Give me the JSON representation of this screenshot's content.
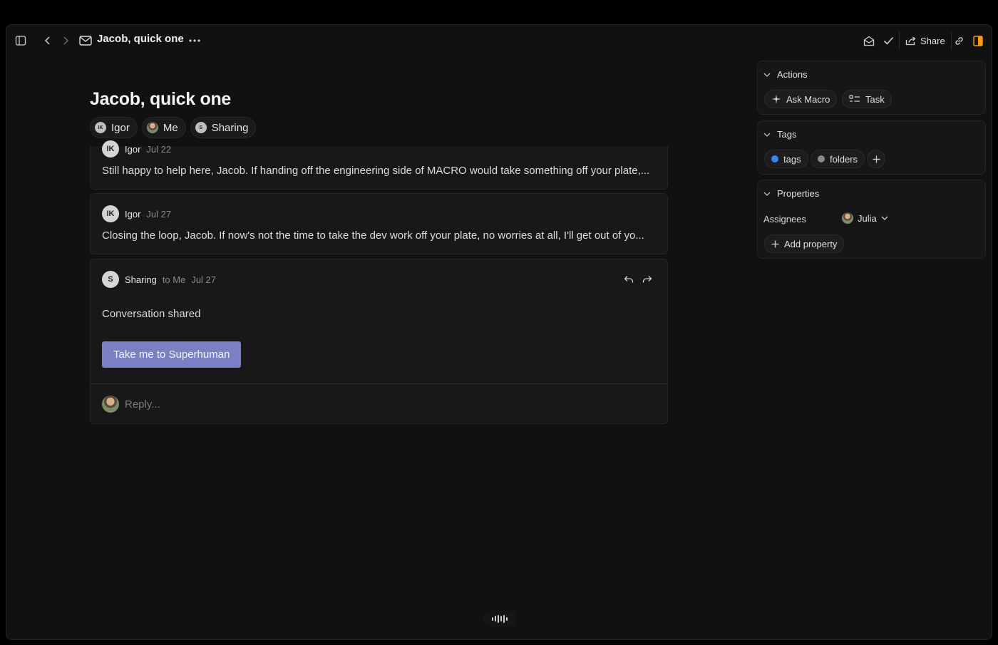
{
  "header": {
    "title": "Jacob, quick one",
    "share_label": "Share"
  },
  "document": {
    "title": "Jacob, quick one",
    "participants": [
      {
        "initials": "IK",
        "name": "Igor"
      },
      {
        "initials": "",
        "name": "Me"
      },
      {
        "initials": "S",
        "name": "Sharing"
      }
    ]
  },
  "messages": [
    {
      "initials": "IK",
      "sender": "Igor",
      "to": "",
      "date": "Jul 22",
      "snippet": "Still happy to help here, Jacob. If handing off the engineering side of MACRO would take something off your plate,..."
    },
    {
      "initials": "IK",
      "sender": "Igor",
      "to": "",
      "date": "Jul 27",
      "snippet": "Closing the loop, Jacob. If now's not the time to take the dev work off your plate, no worries at all, I'll get out of yo..."
    },
    {
      "initials": "S",
      "sender": "Sharing",
      "to": "to Me",
      "date": "Jul 27",
      "body": "Conversation shared",
      "cta": "Take me to Superhuman"
    }
  ],
  "reply": {
    "placeholder": "Reply..."
  },
  "sidebar": {
    "actions": {
      "title": "Actions",
      "items": [
        "Ask Macro",
        "Task"
      ]
    },
    "tags": {
      "title": "Tags",
      "items": [
        {
          "label": "tags",
          "color": "#3b82f6"
        },
        {
          "label": "folders",
          "color": "#8a8a8a"
        }
      ]
    },
    "properties": {
      "title": "Properties",
      "assignees_label": "Assignees",
      "assignee": "Julia",
      "add_label": "Add property"
    }
  },
  "colors": {
    "accent": "#7b7fc4",
    "highlight": "#f59e0b"
  }
}
